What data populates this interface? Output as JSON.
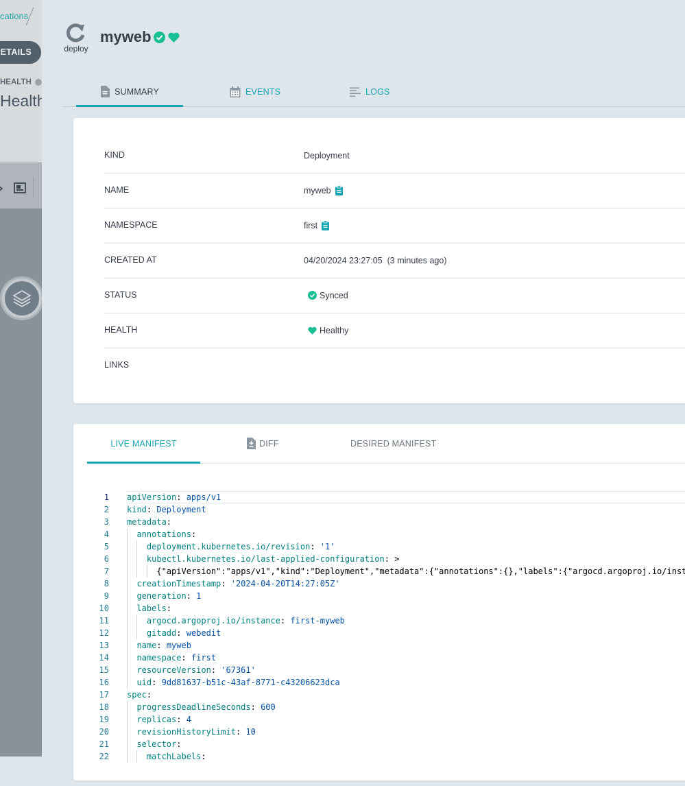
{
  "background": {
    "breadcrumb_text": "cations",
    "details_button": "DETAILS",
    "health_label": "HEALTH",
    "health_value": "Health"
  },
  "header": {
    "kind_label": "deploy",
    "title": "myweb"
  },
  "tabs": {
    "summary": "SUMMARY",
    "events": "EVENTS",
    "logs": "LOGS"
  },
  "summary": {
    "rows": [
      {
        "key": "KIND",
        "value": "Deployment"
      },
      {
        "key": "NAME",
        "value": "myweb"
      },
      {
        "key": "NAMESPACE",
        "value": "first"
      },
      {
        "key": "CREATED AT",
        "value": "04/20/2024 23:27:05  (3 minutes ago)"
      },
      {
        "key": "STATUS",
        "value": "Synced"
      },
      {
        "key": "HEALTH",
        "value": "Healthy"
      },
      {
        "key": "LINKS",
        "value": ""
      }
    ]
  },
  "manifest_tabs": {
    "live": "LIVE MANIFEST",
    "diff": "DIFF",
    "desired": "DESIRED MANIFEST"
  },
  "manifest_lines": [
    {
      "n": "1",
      "indent": 0,
      "key": "apiVersion",
      "sep": ": ",
      "val": "apps/v1"
    },
    {
      "n": "2",
      "indent": 0,
      "key": "kind",
      "sep": ": ",
      "val": "Deployment"
    },
    {
      "n": "3",
      "indent": 0,
      "key": "metadata",
      "sep": ":",
      "val": ""
    },
    {
      "n": "4",
      "indent": 1,
      "key": "annotations",
      "sep": ":",
      "val": ""
    },
    {
      "n": "5",
      "indent": 2,
      "key": "deployment.kubernetes.io/revision",
      "sep": ": ",
      "val": "'1'"
    },
    {
      "n": "6",
      "indent": 2,
      "key": "kubectl.kubernetes.io/last-applied-configuration",
      "sep": ": ",
      "val": ">",
      "val_plain": true
    },
    {
      "n": "7",
      "indent": 3,
      "key": "",
      "sep": "",
      "val": "{\"apiVersion\":\"apps/v1\",\"kind\":\"Deployment\",\"metadata\":{\"annotations\":{},\"labels\":{\"argocd.argoproj.io/instance\":\"first-myweb\"",
      "val_plain": true
    },
    {
      "n": "8",
      "indent": 1,
      "key": "creationTimestamp",
      "sep": ": ",
      "val": "'2024-04-20T14:27:05Z'"
    },
    {
      "n": "9",
      "indent": 1,
      "key": "generation",
      "sep": ": ",
      "val": "1"
    },
    {
      "n": "10",
      "indent": 1,
      "key": "labels",
      "sep": ":",
      "val": ""
    },
    {
      "n": "11",
      "indent": 2,
      "key": "argocd.argoproj.io/instance",
      "sep": ": ",
      "val": "first-myweb"
    },
    {
      "n": "12",
      "indent": 2,
      "key": "gitadd",
      "sep": ": ",
      "val": "webedit"
    },
    {
      "n": "13",
      "indent": 1,
      "key": "name",
      "sep": ": ",
      "val": "myweb"
    },
    {
      "n": "14",
      "indent": 1,
      "key": "namespace",
      "sep": ": ",
      "val": "first"
    },
    {
      "n": "15",
      "indent": 1,
      "key": "resourceVersion",
      "sep": ": ",
      "val": "'67361'"
    },
    {
      "n": "16",
      "indent": 1,
      "key": "uid",
      "sep": ": ",
      "val": "9dd81637-b51c-43af-8771-c43206623dca"
    },
    {
      "n": "17",
      "indent": 0,
      "key": "spec",
      "sep": ":",
      "val": ""
    },
    {
      "n": "18",
      "indent": 1,
      "key": "progressDeadlineSeconds",
      "sep": ": ",
      "val": "600"
    },
    {
      "n": "19",
      "indent": 1,
      "key": "replicas",
      "sep": ": ",
      "val": "4"
    },
    {
      "n": "20",
      "indent": 1,
      "key": "revisionHistoryLimit",
      "sep": ": ",
      "val": "10"
    },
    {
      "n": "21",
      "indent": 1,
      "key": "selector",
      "sep": ":",
      "val": ""
    },
    {
      "n": "22",
      "indent": 2,
      "key": "matchLabels",
      "sep": ":",
      "val": ""
    }
  ],
  "colors": {
    "accent": "#18a5b4",
    "synced_green": "#18be94",
    "text": "#363c4a"
  }
}
